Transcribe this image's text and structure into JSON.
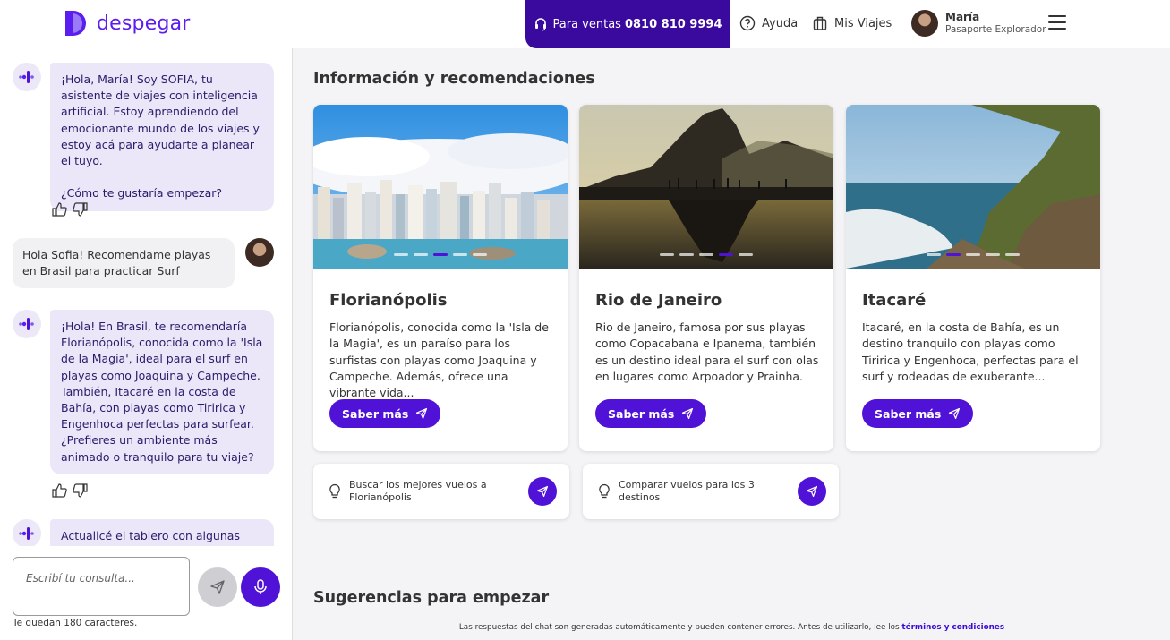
{
  "header": {
    "brand": "despegar",
    "sales_label": "Para ventas",
    "sales_phone": "0810 810 9994",
    "help_label": "Ayuda",
    "trips_label": "Mis Viajes",
    "user_name": "María",
    "user_tier": "Pasaporte Explorador"
  },
  "chat": {
    "messages": [
      {
        "from": "bot",
        "text": "¡Hola, María! Soy SOFIA, tu asistente de viajes con inteligencia artificial. Estoy aprendiendo del emocionante mundo de los viajes y estoy acá para ayudarte a planear el tuyo.\n\n¿Cómo te gustaría empezar?"
      },
      {
        "from": "user",
        "text": "Hola Sofia! Recomendame playas en Brasil para practicar Surf"
      },
      {
        "from": "bot",
        "text": "¡Hola! En Brasil, te recomendaría Florianópolis, conocida como la 'Isla de la Magia', ideal para el surf en playas como Joaquina y Campeche. También, Itacaré en la costa de Bahía, con playas como Tiririca y Engenhoca perfectas para surfear. ¿Prefieres un ambiente más animado o tranquilo para tu viaje?"
      },
      {
        "from": "bot",
        "text": "Actualicé el tablero con algunas sugerencias para vos."
      }
    ],
    "input_placeholder": "Escribí tu consulta...",
    "char_count": "Te quedan 180 caracteres."
  },
  "main": {
    "section_title": "Información y recomendaciones",
    "cards": [
      {
        "title": "Florianópolis",
        "desc": "Florianópolis, conocida como la 'Isla de la Magia', es un paraíso para los surfistas con playas como Joaquina y Campeche. Además, ofrece una vibrante vida...",
        "button": "Saber más",
        "active_dot": 3
      },
      {
        "title": "Rio de Janeiro",
        "desc": "Rio de Janeiro, famosa por sus playas como Copacabana e Ipanema, también es un destino ideal para el surf con olas en lugares como Arpoador y Prainha.",
        "button": "Saber más",
        "active_dot": 4
      },
      {
        "title": "Itacaré",
        "desc": "Itacaré, en la costa de Bahía, es un destino tranquilo con playas como Tiririca y Engenhoca, perfectas para el surf y rodeadas de exuberante...",
        "button": "Saber más",
        "active_dot": 2
      }
    ],
    "suggestions": [
      "Buscar los mejores vuelos a Florianópolis",
      "Comparar vuelos para los 3 destinos"
    ],
    "second_title": "Sugerencias para empezar",
    "disclaimer_text": "Las respuestas del chat son generadas automáticamente y pueden contener errores. Antes de utilizarlo, lee los",
    "disclaimer_link": "términos y condiciones"
  },
  "colors": {
    "brand_purple": "#4f12d6",
    "sales_bg": "#3a0a9e",
    "bot_bubble": "#ebe6f8"
  }
}
